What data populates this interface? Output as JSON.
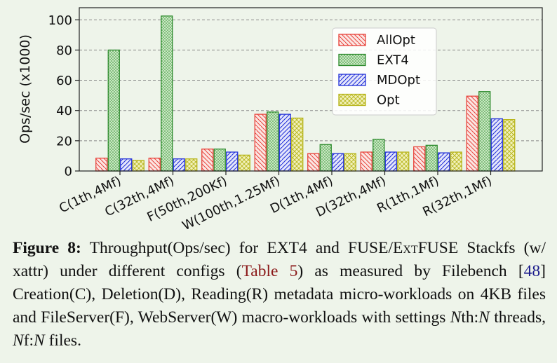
{
  "chart_data": {
    "type": "bar",
    "ylabel": "Ops/sec (x1000)",
    "xlabel": "",
    "ylim": [
      0,
      108
    ],
    "yticks": [
      0,
      20,
      40,
      60,
      80,
      100
    ],
    "grid": "horizontal dashed",
    "legend_position": "top-right",
    "categories": [
      "C(1th,4Mf)",
      "C(32th,4Mf)",
      "F(50th,200Kf)",
      "W(100th,1.25Mf)",
      "D(1th,4Mf)",
      "D(32th,4Mf)",
      "R(1th,1Mf)",
      "R(32th,1Mf)"
    ],
    "series": [
      {
        "name": "AllOpt",
        "color": "#e8423a",
        "fill": "#fbe6e3",
        "pattern": "diag-back",
        "values": [
          8.5,
          8.5,
          14.5,
          37.5,
          11.5,
          12.5,
          16,
          49.5
        ]
      },
      {
        "name": "EXT4",
        "color": "#2e8b2e",
        "fill": "#c9e8c2",
        "pattern": "dots",
        "values": [
          80,
          102.5,
          14.5,
          39,
          17.5,
          21,
          17,
          52.5
        ]
      },
      {
        "name": "MDOpt",
        "color": "#2230d8",
        "fill": "#e4e6fb",
        "pattern": "diag-fwd",
        "values": [
          8,
          8,
          12.5,
          37.5,
          11.5,
          12.5,
          12,
          34.5
        ]
      },
      {
        "name": "Opt",
        "color": "#b7b51c",
        "fill": "#f2f1bb",
        "pattern": "crosshatch",
        "values": [
          7,
          8,
          10.5,
          35,
          11.5,
          12.5,
          12.5,
          34
        ]
      }
    ]
  },
  "caption": {
    "label": "Figure 8:",
    "t1": " Throughput(Ops/sec) for EXT4 and FUSE/E",
    "t1_sc": "xt",
    "t2": "FUSE Stackfs (w/ xattr) under different configs (",
    "table_ref": "Table 5",
    "t3": ") as measured by Filebench [",
    "cite": "48",
    "t4": "] Creation(C), Deletion(D), Reading(R) metadata micro-workloads on 4KB files and FileServer(F), WebServer(W) macro-workloads with settings ",
    "n1": "N",
    "t5": "th:",
    "n2": "N",
    "t6": " threads, ",
    "n3": "N",
    "t7": "f:",
    "n4": "N",
    "t8": " files."
  }
}
